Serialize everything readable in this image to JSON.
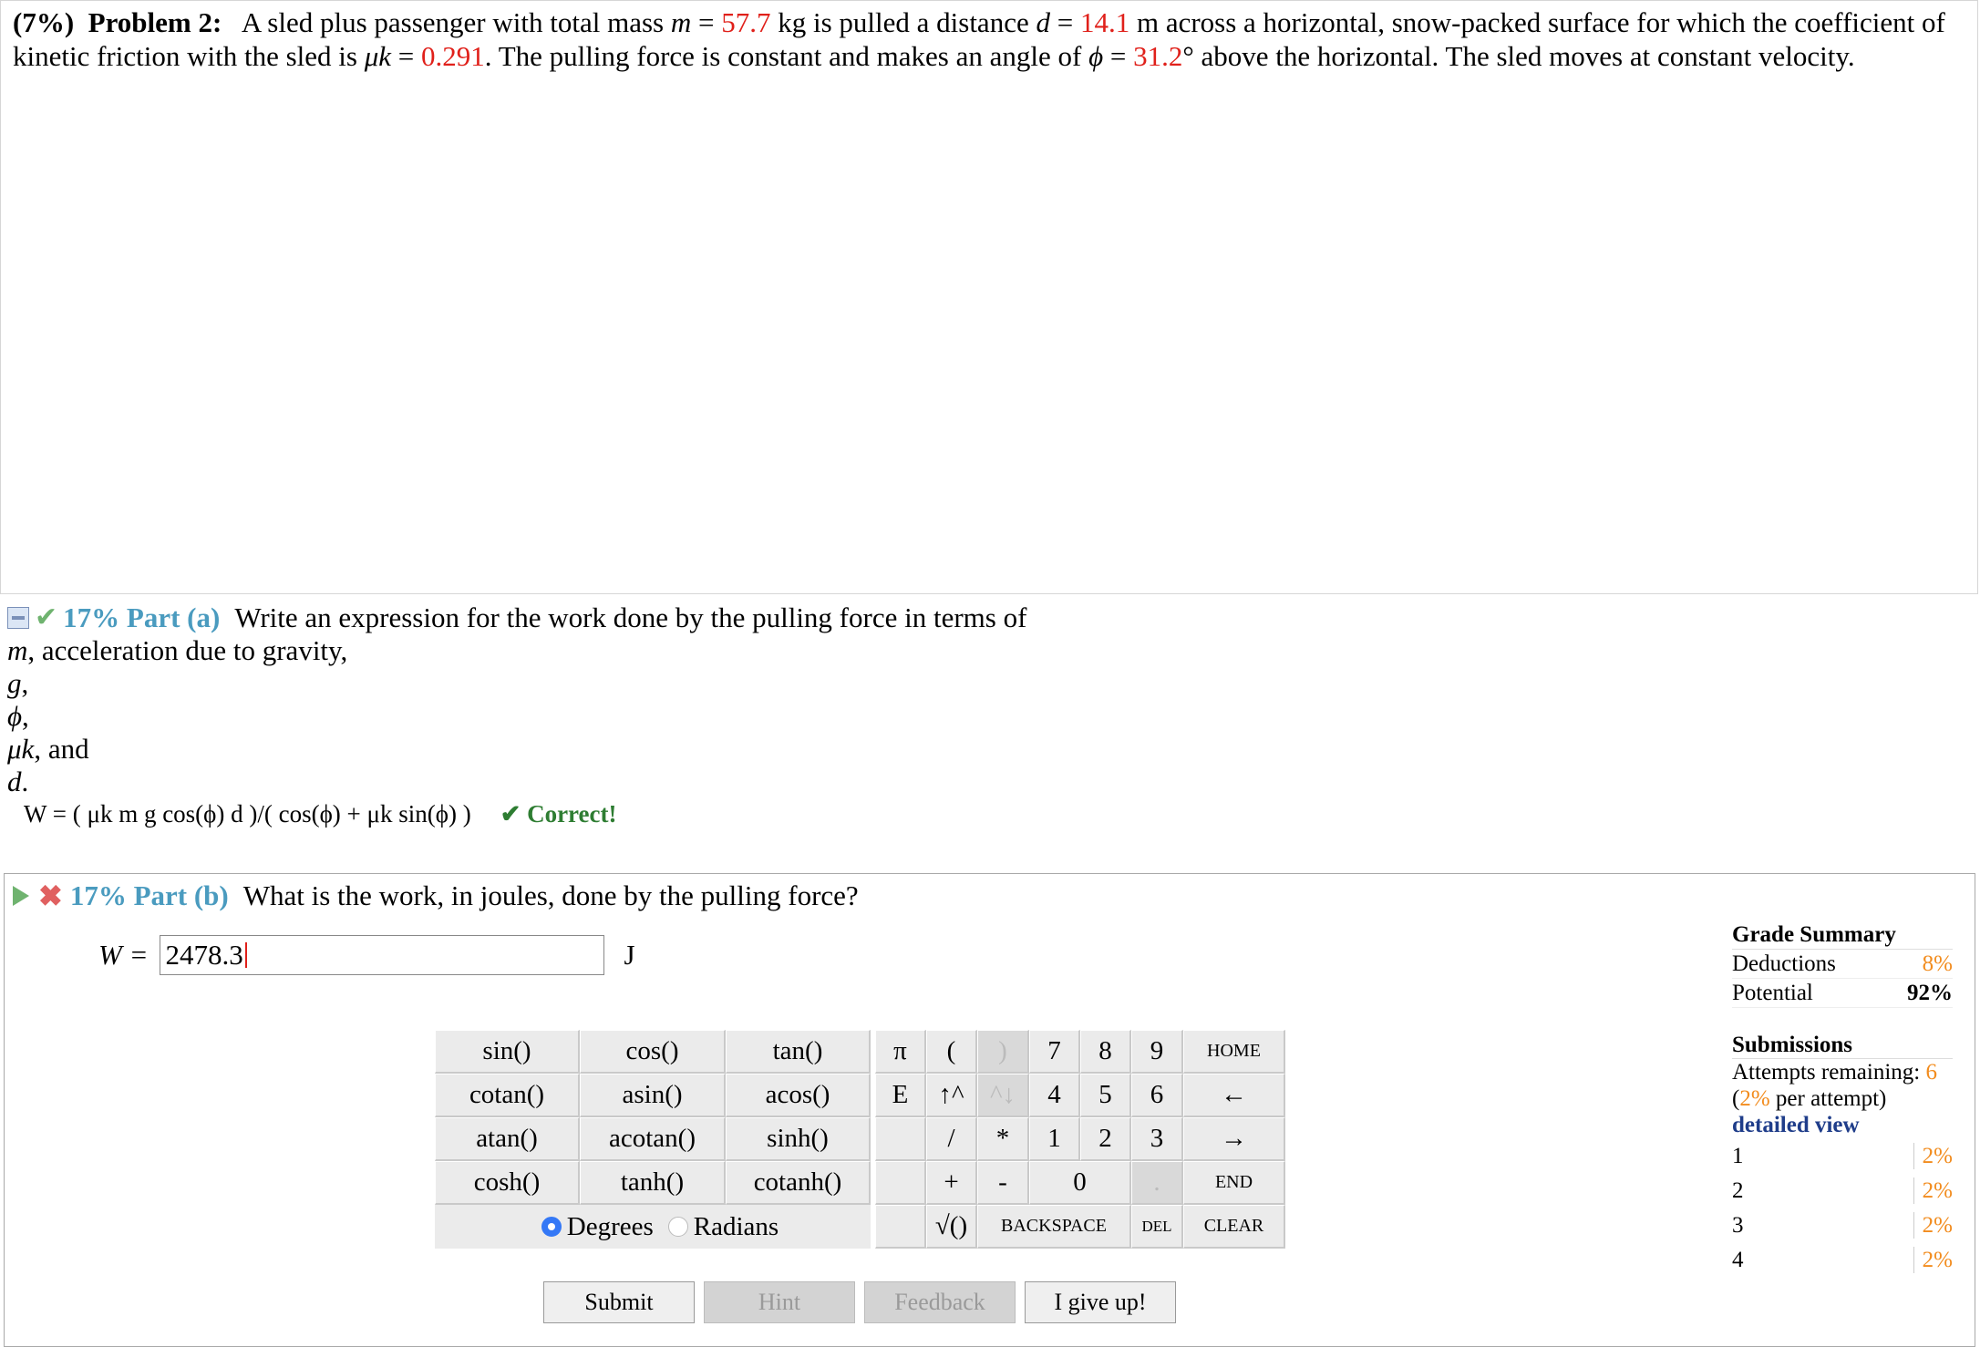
{
  "problem": {
    "weight": "(7%)",
    "label": "Problem 2:",
    "text1": "A sled plus passenger with total mass",
    "m_sym": "m",
    "eq": " = ",
    "m_val": "57.7",
    "text2": " kg is pulled a distance ",
    "d_sym": "d",
    "d_val": "14.1",
    "text3": " m across a horizontal, snow-packed surface for which the coefficient of kinetic friction with the sled is ",
    "mu_sym": "μk",
    "mu_val": "0.291",
    "text4": ". The pulling force is constant and makes an angle of ",
    "phi_sym": "ϕ",
    "phi_val": "31.2",
    "text5": "° above the horizontal. The sled moves at constant velocity."
  },
  "part_a": {
    "title": "17% Part (a)",
    "prompt_1": "Write an expression for the work done by the pulling force in terms of",
    "line_m": "m",
    "line_m_rest": ", acceleration due to gravity,",
    "line_g": "g",
    "line_g_rest": ",",
    "line_phi": "ϕ",
    "line_phi_rest": ",",
    "line_mu": "μk",
    "line_mu_rest": ", and",
    "line_d": "d",
    "line_d_rest": ".",
    "answer": "W = ( μk m g cos(ϕ) d )/( cos(ϕ) + μk sin(ϕ) )",
    "status": "✔ Correct!"
  },
  "part_b": {
    "title": "17% Part (b)",
    "prompt": "What is the work, in joules, done by the pulling force?",
    "var_label": "W = ",
    "input_value": "2478.3",
    "unit": "J"
  },
  "calculator": {
    "functions": [
      "sin()",
      "cos()",
      "tan()",
      "cotan()",
      "asin()",
      "acos()",
      "atan()",
      "acotan()",
      "sinh()",
      "cosh()",
      "tanh()",
      "cotanh()"
    ],
    "degrees": "Degrees",
    "radians": "Radians",
    "keys_row1": [
      "π",
      "(",
      ")",
      "7",
      "8",
      "9",
      "HOME"
    ],
    "keys_row2": [
      "E",
      "↑^",
      "^↓",
      "4",
      "5",
      "6",
      "←"
    ],
    "keys_row3": [
      "",
      "/",
      "*",
      "1",
      "2",
      "3",
      "→"
    ],
    "keys_row4": [
      "",
      "+",
      "-",
      "0",
      ".",
      "END"
    ],
    "keys_row5": [
      "",
      "√()",
      "BACKSPACE",
      "DEL",
      "CLEAR"
    ]
  },
  "buttons": {
    "submit": "Submit",
    "hint": "Hint",
    "feedback": "Feedback",
    "give_up": "I give up!"
  },
  "grade_summary": {
    "title": "Grade Summary",
    "deductions_label": "Deductions",
    "deductions_value": "8%",
    "potential_label": "Potential",
    "potential_value": "92%"
  },
  "submissions": {
    "title": "Submissions",
    "attempts_label": "Attempts remaining: ",
    "attempts_value": "6",
    "per_attempt_pre": "(",
    "per_attempt_value": "2%",
    "per_attempt_post": " per attempt)",
    "detailed_view": "detailed view",
    "rows": [
      {
        "n": "1",
        "v": "2%"
      },
      {
        "n": "2",
        "v": "2%"
      },
      {
        "n": "3",
        "v": "2%"
      },
      {
        "n": "4",
        "v": "2%"
      }
    ]
  },
  "colors": {
    "given_value": "#e0201a",
    "part_title": "#4a9bbf",
    "correct": "#2e7d32",
    "orange": "#f28c1e"
  }
}
